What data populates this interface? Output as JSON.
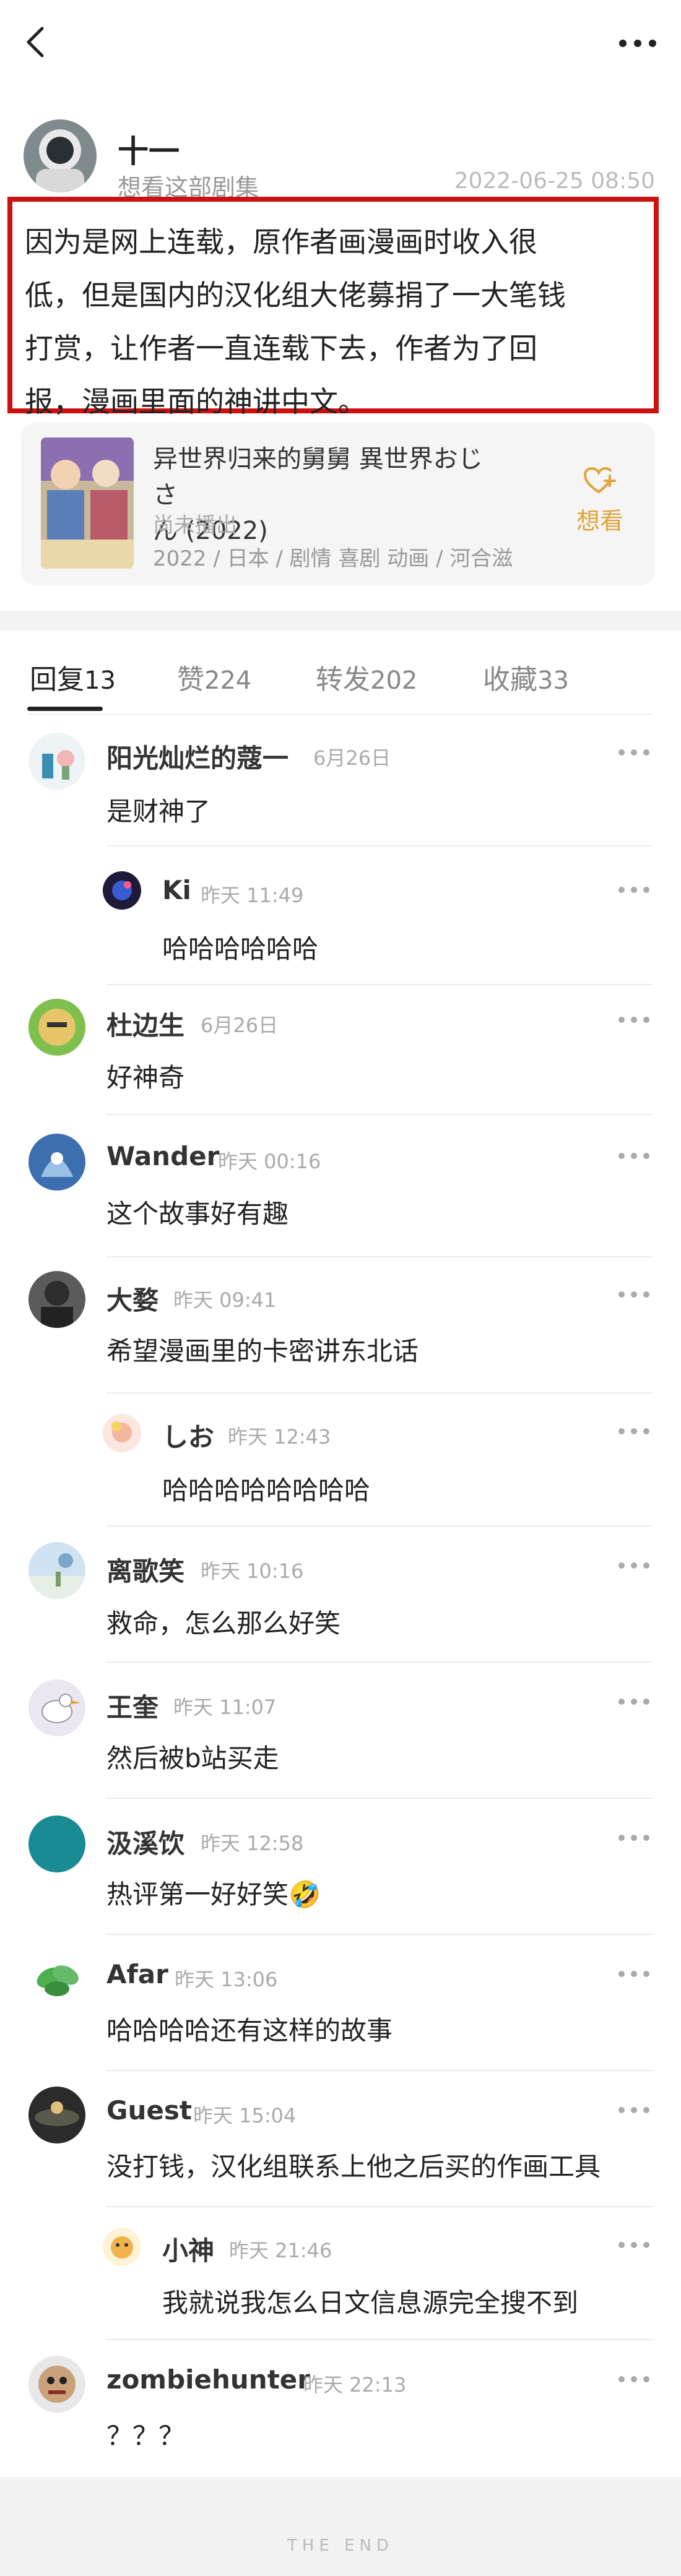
{
  "post": {
    "author_name": "十一",
    "author_sub": "想看这部剧集",
    "time": "2022-06-25 08:50",
    "text": "因为是网上连载，原作者画漫画时收入很低，但是国内的汉化组大佬募捐了一大笔钱打赏，让作者一直连载下去，作者为了回报，漫画里面的神讲中文。",
    "line1": "因为是网上连载，原作者画漫画时收入很",
    "line2": "低，但是国内的汉化组大佬募捐了一大笔钱",
    "line3": "打赏，让作者一直连载下去，作者为了回",
    "line4": "报，漫画里面的神讲中文。"
  },
  "subject": {
    "title_line1": "异世界归来的舅舅 異世界おじさ",
    "title_line2": "ん (2022)",
    "status": "尚未播出",
    "meta": "2022 / 日本 / 剧情 喜剧 动画 / 河合滋",
    "want_label": "想看",
    "accent_color": "#e2a33a"
  },
  "tabs": [
    {
      "label": "回复",
      "count": "13"
    },
    {
      "label": "赞",
      "count": "224"
    },
    {
      "label": "转发",
      "count": "202"
    },
    {
      "label": "收藏",
      "count": "33"
    }
  ],
  "replies": [
    {
      "name": "阳光灿烂的蔻一",
      "time": "6月26日",
      "text": "是财神了"
    },
    {
      "name": "Ki",
      "time": "昨天 11:49",
      "text": "哈哈哈哈哈哈"
    },
    {
      "name": "杜边生",
      "time": "6月26日",
      "text": "好神奇"
    },
    {
      "name": "Wander",
      "time": "昨天 00:16",
      "text": "这个故事好有趣"
    },
    {
      "name": "大婺",
      "time": "昨天 09:41",
      "text": "希望漫画里的卡密讲东北话"
    },
    {
      "name": "しお",
      "time": "昨天 12:43",
      "text": "哈哈哈哈哈哈哈哈"
    },
    {
      "name": "离歌笑",
      "time": "昨天 10:16",
      "text": "救命，怎么那么好笑"
    },
    {
      "name": "王奎",
      "time": "昨天 11:07",
      "text": "然后被b站买走"
    },
    {
      "name": "汲溪饮",
      "time": "昨天 12:58",
      "text": "热评第一好好笑🤣"
    },
    {
      "name": "Afar",
      "time": "昨天 13:06",
      "text": "哈哈哈哈还有这样的故事"
    },
    {
      "name": "Guest",
      "time": "昨天 15:04",
      "text": "没打钱，汉化组联系上他之后买的作画工具"
    },
    {
      "name": "小神",
      "time": "昨天 21:46",
      "text": "我就说我怎么日文信息源完全搜不到"
    },
    {
      "name": "zombiehunter",
      "time": "昨天 22:13",
      "text": "？？？"
    }
  ],
  "footer": "THE END"
}
